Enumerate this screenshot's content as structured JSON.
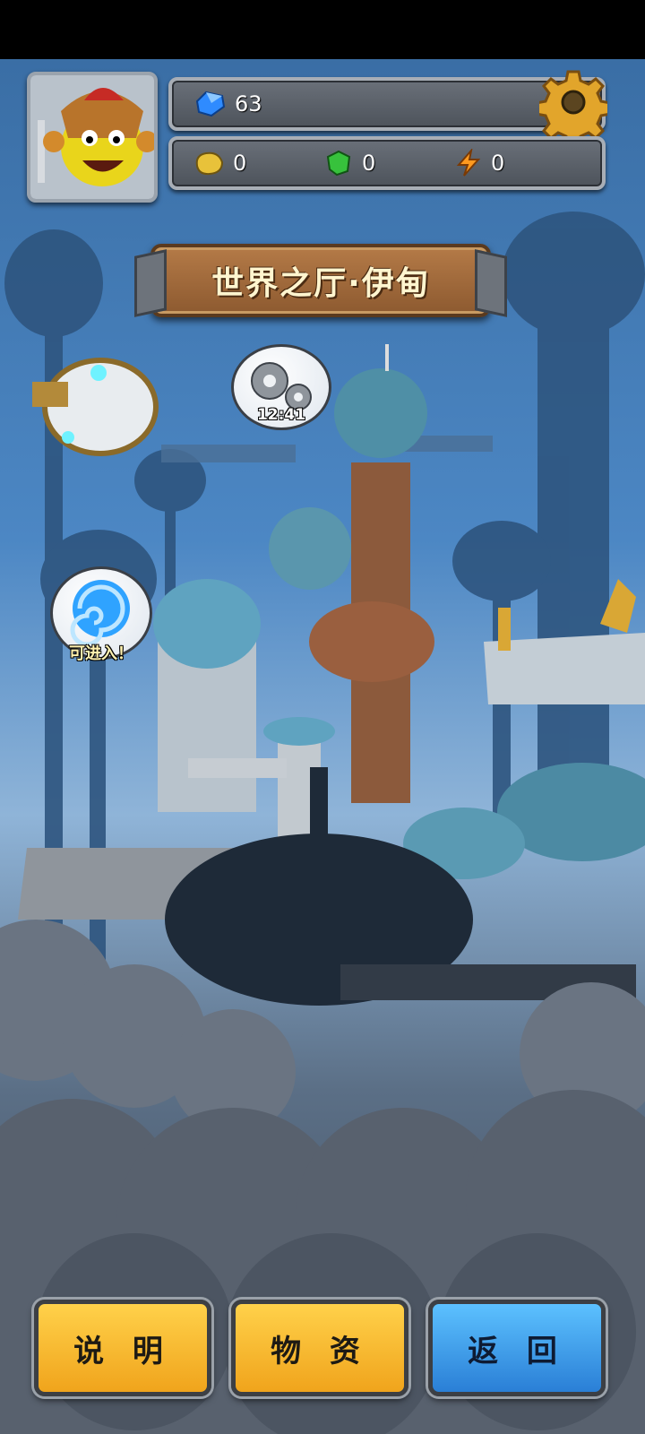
{
  "hud": {
    "gems": "63",
    "resources": [
      {
        "icon": "gold-ore-icon",
        "value": "0"
      },
      {
        "icon": "green-crystal-icon",
        "value": "0"
      },
      {
        "icon": "lightning-energy-icon",
        "value": "0"
      }
    ]
  },
  "title": "世界之厅·伊甸",
  "map": {
    "workshop_timer": "12:41",
    "portal_label": "可进入！"
  },
  "buttons": {
    "help": "说 明",
    "supplies": "物 资",
    "back": "返 回"
  },
  "colors": {
    "gold_button": "#f0a41c",
    "blue_button": "#2a7fd6",
    "sky": "#4c87c4"
  }
}
